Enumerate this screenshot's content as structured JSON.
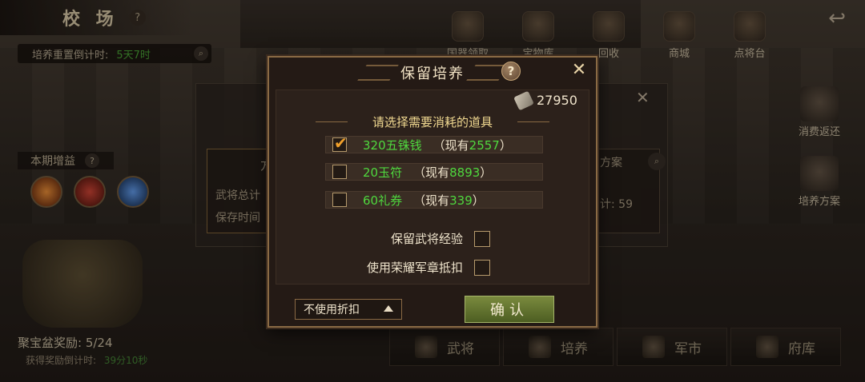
{
  "header": {
    "title": "校 场",
    "help": "?",
    "reset_label": "培养重置倒计时:",
    "reset_value": "5天7时"
  },
  "top_menu": [
    {
      "label": "国器领取",
      "icon": "scroll-icon"
    },
    {
      "label": "宝物库",
      "icon": "treasure-icon"
    },
    {
      "label": "回收",
      "icon": "recycle-icon"
    },
    {
      "label": "商城",
      "icon": "shop-icon"
    },
    {
      "label": "点将台",
      "icon": "general-icon"
    }
  ],
  "right_menu": [
    {
      "label": "消费返还",
      "icon": "gift-icon"
    },
    {
      "label": "培养方案",
      "icon": "scroll-plan-icon"
    }
  ],
  "left": {
    "bonus_label": "本期增益",
    "bonus_help": "?",
    "pot_label": "聚宝盆奖励: 5/24",
    "pot_sub_label": "获得奖励倒计时:",
    "pot_sub_value": "39分10秒"
  },
  "back_panel": {
    "card_head": "方",
    "card_line1": "武将总计",
    "card_line2": "保存时间",
    "right_head": "方案",
    "right_num": "计: 59"
  },
  "bottom_tabs": [
    {
      "label": "武将",
      "icon": "soldier-icon"
    },
    {
      "label": "培养",
      "icon": "sword-icon"
    },
    {
      "label": "军市",
      "icon": "market-icon"
    },
    {
      "label": "府库",
      "icon": "storehouse-icon"
    }
  ],
  "modal": {
    "title": "保留培养",
    "help": "?",
    "close": "✕",
    "currency_value": "27950",
    "section_title": "请选择需要消耗的道具",
    "options": [
      {
        "name": "320五铢钱",
        "have_prefix": "（现有",
        "have_num": "2557",
        "have_suffix": "）",
        "checked": true
      },
      {
        "name": "20玉符",
        "have_prefix": "（现有",
        "have_num": "8893",
        "have_suffix": "）",
        "checked": false
      },
      {
        "name": "60礼券",
        "have_prefix": "（现有",
        "have_num": "339",
        "have_suffix": "）",
        "checked": false
      }
    ],
    "toggles": [
      {
        "label": "保留武将经验",
        "checked": false
      },
      {
        "label": "使用荣耀军章抵扣",
        "checked": false
      }
    ],
    "discount_selected": "不使用折扣",
    "confirm_label": "确认"
  },
  "colors": {
    "accent_green": "#4fd83e",
    "gold_border": "#8a6a44",
    "check_orange": "#f1a02a",
    "confirm_green": "#6b7a34"
  }
}
